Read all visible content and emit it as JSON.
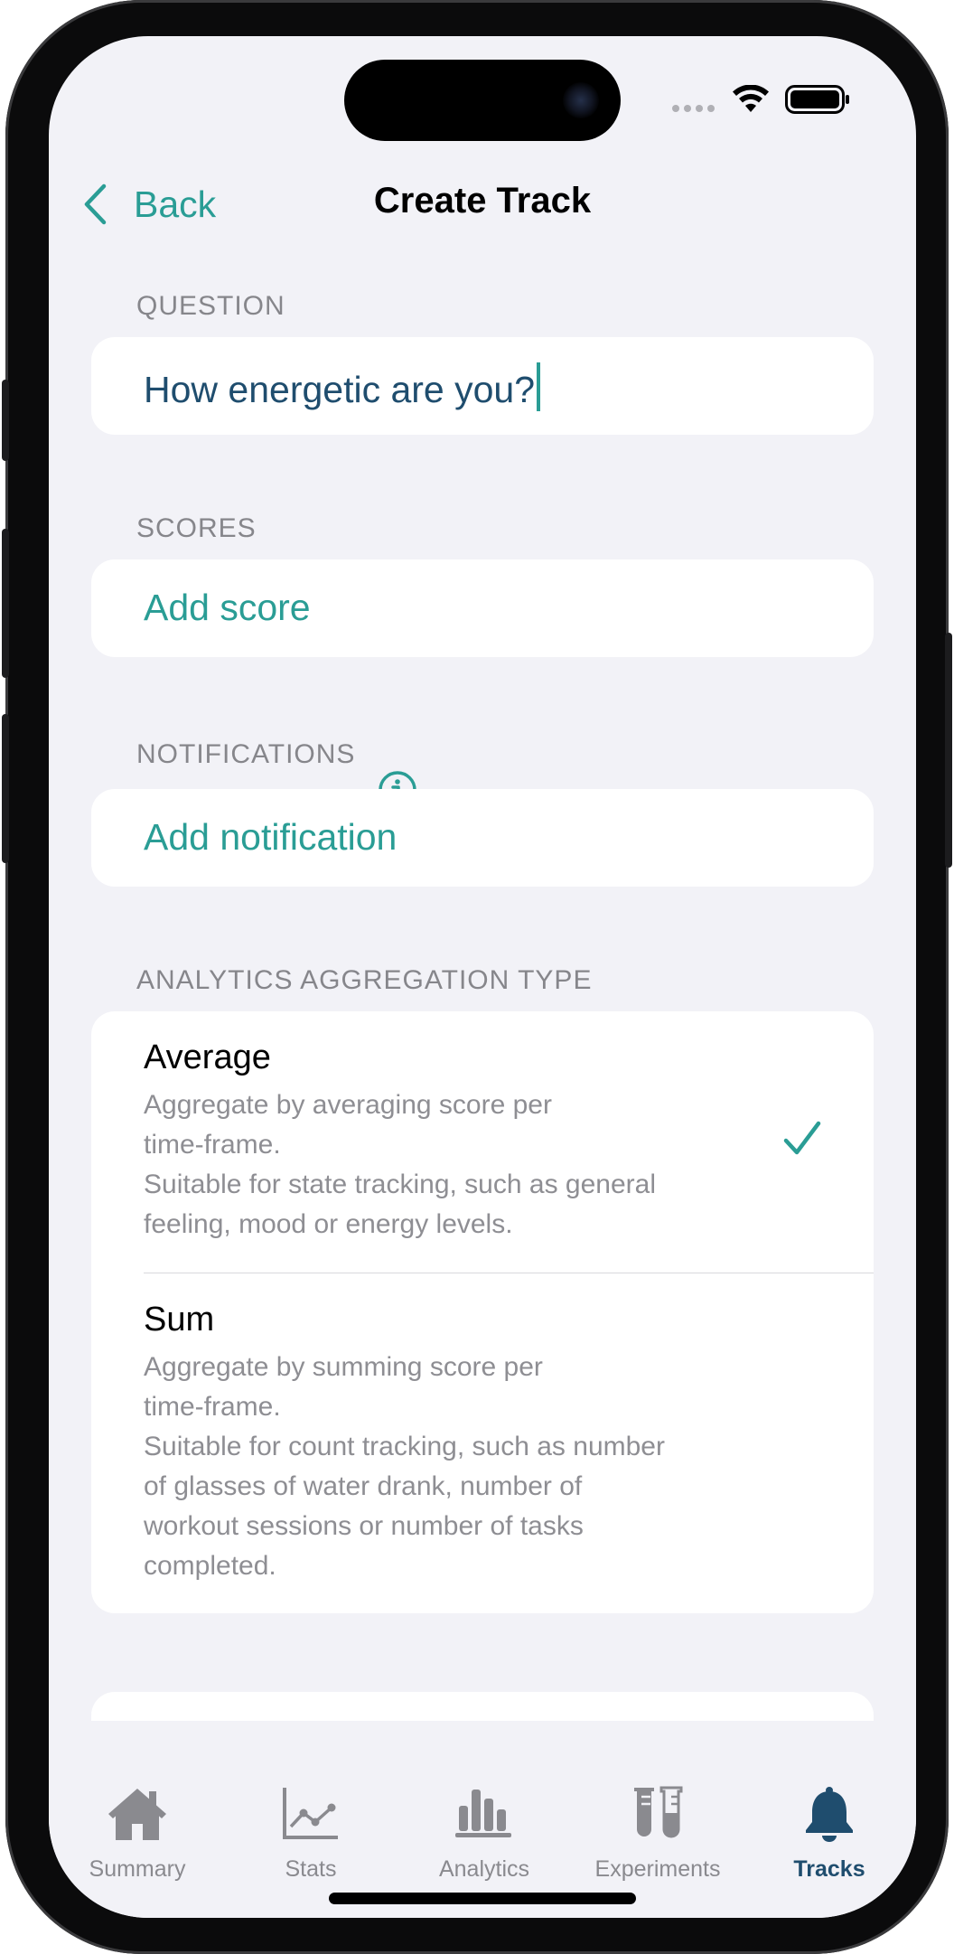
{
  "nav": {
    "back_label": "Back",
    "title": "Create Track"
  },
  "question": {
    "label": "QUESTION",
    "value": "How energetic are you?"
  },
  "scores": {
    "label": "SCORES",
    "add_label": "Add score"
  },
  "notifications": {
    "label": "NOTIFICATIONS",
    "add_label": "Add notification",
    "info_icon": "info-circle-icon"
  },
  "aggregation": {
    "label": "ANALYTICS AGGREGATION TYPE",
    "selected": "Average",
    "options": [
      {
        "title": "Average",
        "desc_lines": [
          "Aggregate by averaging score per",
          "time-frame.",
          "Suitable for state tracking, such as general",
          "feeling, mood or energy levels."
        ]
      },
      {
        "title": "Sum",
        "desc_lines": [
          "Aggregate by summing score per",
          "time-frame.",
          "Suitable for count tracking, such as number",
          "of glasses of water drank, number of",
          "workout sessions or number of tasks",
          "completed."
        ]
      }
    ]
  },
  "tabs": [
    {
      "label": "Summary",
      "icon": "house-icon"
    },
    {
      "label": "Stats",
      "icon": "line-chart-icon"
    },
    {
      "label": "Analytics",
      "icon": "bar-chart-icon"
    },
    {
      "label": "Experiments",
      "icon": "test-tubes-icon"
    },
    {
      "label": "Tracks",
      "icon": "bell-icon",
      "active": true
    }
  ],
  "colors": {
    "accent": "#2a9d95",
    "active_tab": "#1f4d6e",
    "background": "#f2f2f7",
    "inactive": "#8a8a8f"
  }
}
